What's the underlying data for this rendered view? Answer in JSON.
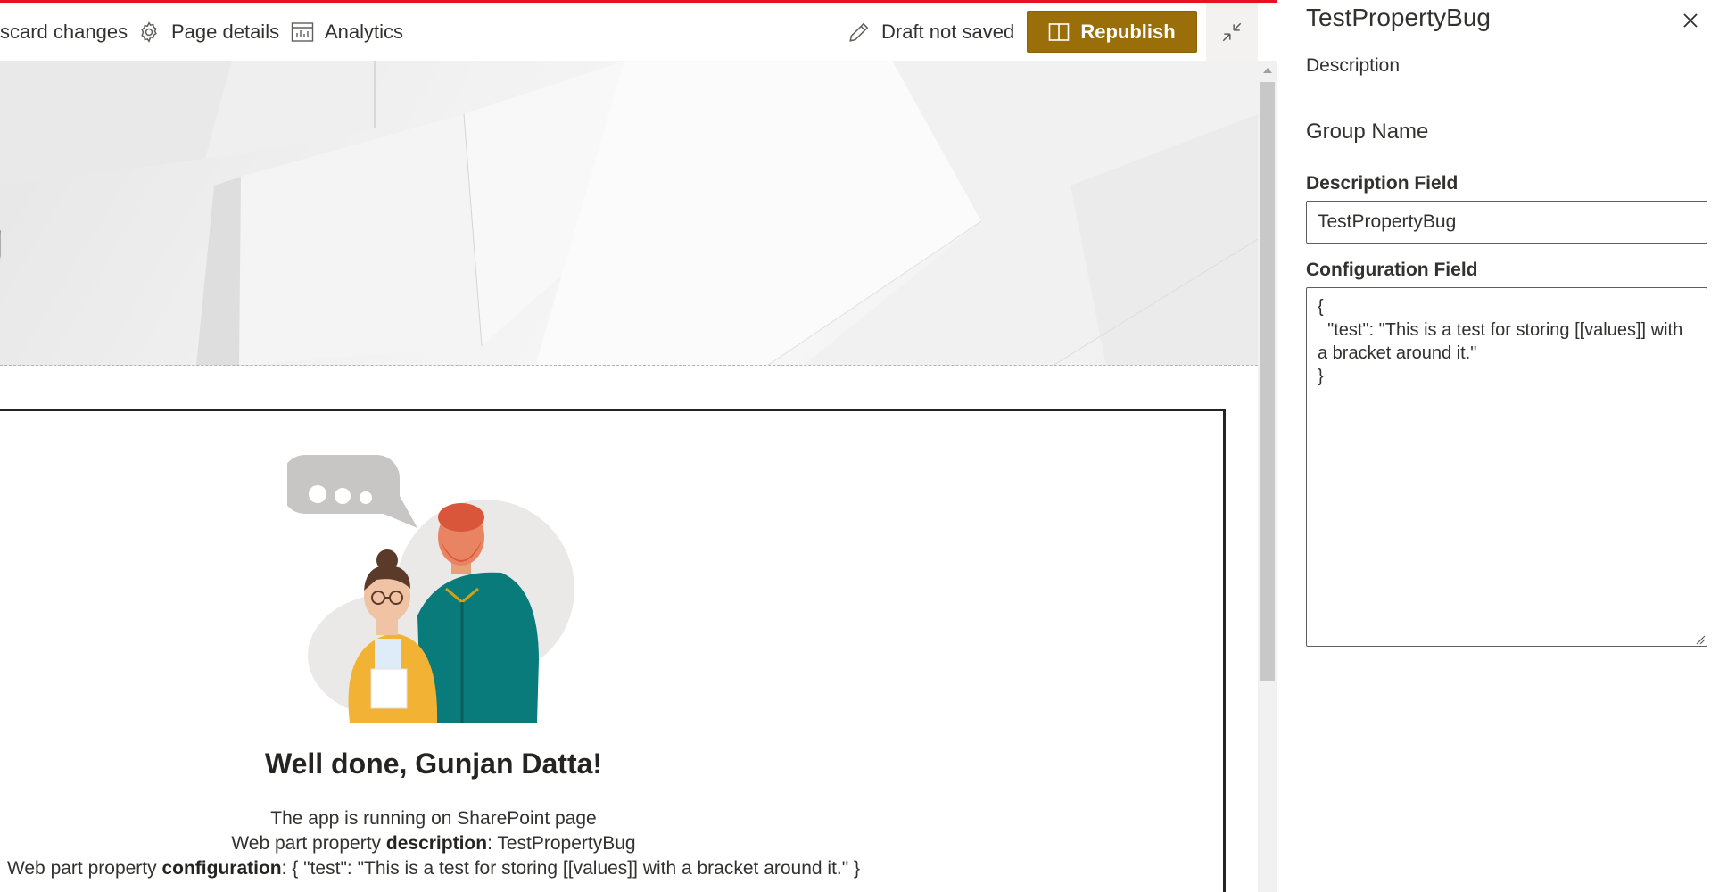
{
  "command_bar": {
    "discard_label": "scard changes",
    "page_details_label": "Page details",
    "analytics_label": "Analytics",
    "draft_status": "Draft not saved",
    "republish_label": "Republish"
  },
  "banner": {
    "title_fragment": "g"
  },
  "webpart": {
    "heading": "Well done, Gunjan Datta!",
    "line1": "The app is running on SharePoint page",
    "line2_prefix": "Web part property ",
    "line2_bold": "description",
    "line2_value": ": TestPropertyBug",
    "line3_prefix": "Web part property ",
    "line3_bold": "configuration",
    "line3_value": ": { \"test\": \"This is a test for storing [[values]] with a bracket around it.\" }"
  },
  "property_pane": {
    "title": "TestPropertyBug",
    "description": "Description",
    "group_name": "Group Name",
    "description_field_label": "Description Field",
    "description_field_value": "TestPropertyBug",
    "configuration_field_label": "Configuration Field",
    "configuration_field_value": "{\n  \"test\": \"This is a test for storing [[values]] with a bracket around it.\"\n}"
  },
  "colors": {
    "accent": "#9a6f0a",
    "top_bar_line": "#e81123",
    "text": "#323130"
  },
  "icons": [
    "gear-icon",
    "analytics-icon",
    "pencil-icon",
    "book-icon",
    "collapse-icon",
    "close-icon"
  ]
}
